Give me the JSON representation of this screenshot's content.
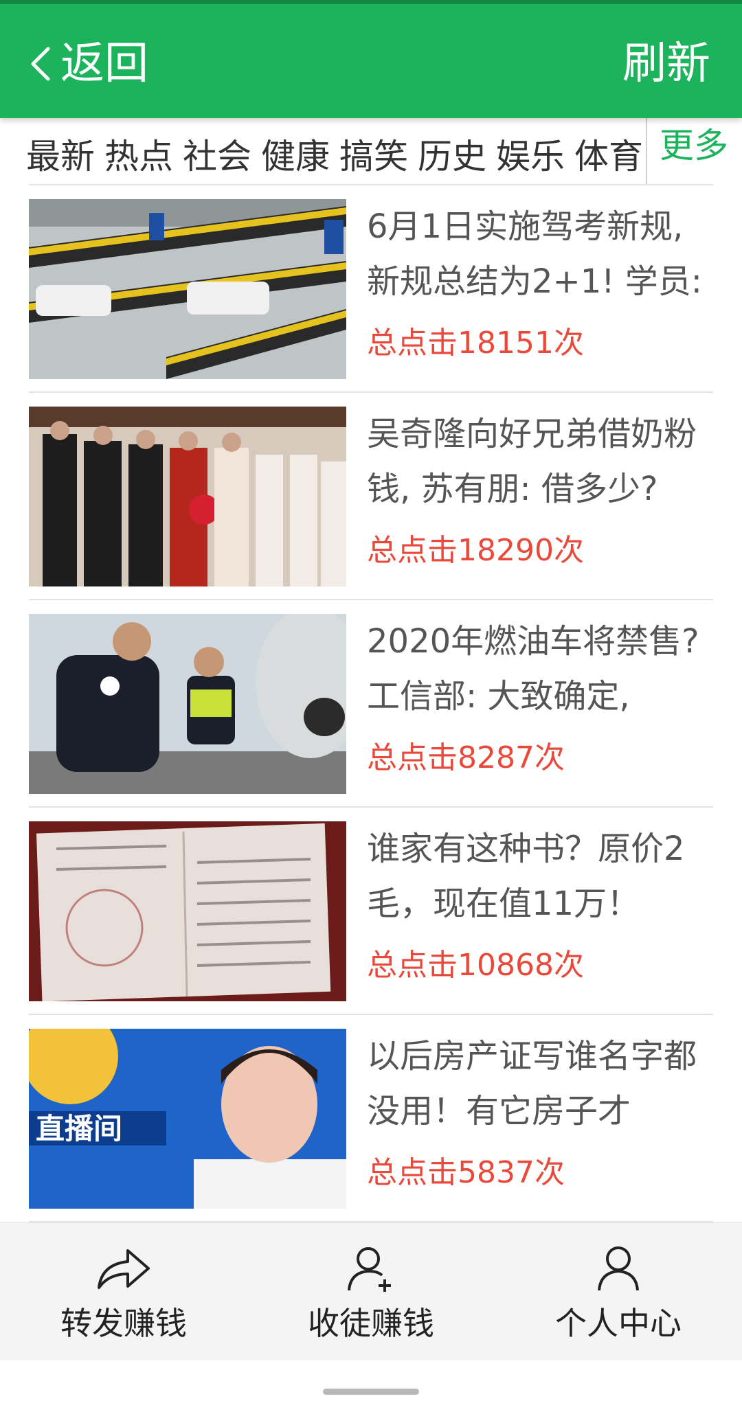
{
  "header": {
    "back_label": "返回",
    "refresh_label": "刷新",
    "accent_color": "#1db35c"
  },
  "categories": {
    "items": [
      "最新",
      "热点",
      "社会",
      "健康",
      "搞笑",
      "历史",
      "娱乐",
      "体育"
    ],
    "more_label": "更多"
  },
  "feed": [
    {
      "title": "6月1日实施驾考新规, 新规总结为2+1! 学员:",
      "clicks": "总点击18151次",
      "thumb": "driving-test-track-photo"
    },
    {
      "title": "吴奇隆向好兄弟借奶粉钱, 苏有朋: 借多少?",
      "clicks": "总点击18290次",
      "thumb": "wedding-photo"
    },
    {
      "title": "2020年燃油车将禁售? 工信部: 大致确定,",
      "clicks": "总点击8287次",
      "thumb": "exhaust-inspection-photo"
    },
    {
      "title": "谁家有这种书？原价2毛，现在值11万！",
      "clicks": "总点击10868次",
      "thumb": "old-booklet-photo"
    },
    {
      "title": "以后房产证写谁名字都没用！有它房子才",
      "clicks": "总点击5837次",
      "thumb": "news-anchor-photo"
    }
  ],
  "bottom_nav": {
    "share": "转发赚钱",
    "recruit": "收徒赚钱",
    "profile": "个人中心"
  },
  "colors": {
    "click_count": "#e8493b"
  }
}
